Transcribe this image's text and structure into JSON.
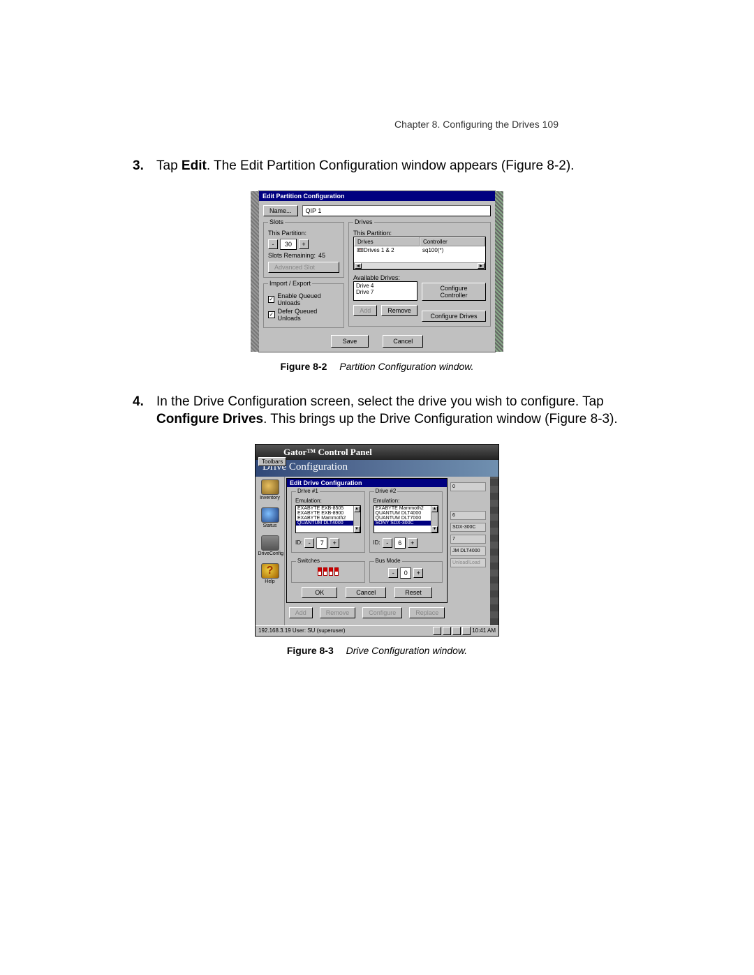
{
  "header": "Chapter 8. Configuring the Drives   109",
  "steps": {
    "s3_num": "3.",
    "s3_a": "Tap ",
    "s3_b": "Edit",
    "s3_c": ". The Edit Partition Configuration window appears (Figure 8-2).",
    "s4_num": "4.",
    "s4_a": "In the Drive Configuration screen, select the drive you wish to configure. Tap ",
    "s4_b": "Configure Drives",
    "s4_c": ". This brings up the Drive Configuration window (Figure 8-3)."
  },
  "fig82": {
    "label": "Figure 8-2",
    "title": "Partition Configuration window.",
    "win_title": "Edit Partition Configuration",
    "name_btn": "Name...",
    "name_value": "QIP 1",
    "slots_legend": "Slots",
    "slots_thispart": "This Partition:",
    "slots_value": "30",
    "slots_remaining_lbl": "Slots Remaining:",
    "slots_remaining_val": "45",
    "adv_slot": "Advanced Slot",
    "impexp_legend": "Import / Export",
    "chk1": "Enable Queued Unloads",
    "chk2": "Defer Queued Unloads",
    "drives_legend": "Drives",
    "drives_thispart": "This Partition:",
    "col_drives": "Drives",
    "col_ctrl": "Controller",
    "row_drives": "Drives 1 & 2",
    "row_ctrl": "sq100(*)",
    "avail_lbl": "Available Drives:",
    "avail_1": "Drive 4",
    "avail_2": "Drive 7",
    "cfg_ctrl": "Configure Controller",
    "cfg_drv": "Configure Drives",
    "add": "Add",
    "remove": "Remove",
    "save": "Save",
    "cancel": "Cancel"
  },
  "fig83": {
    "label": "Figure 8-3",
    "title": "Drive Configuration window.",
    "banner": "Gator™ Control Panel",
    "toolbars": "Toolbars",
    "subtitle": "Drive Configuration",
    "sidebar": {
      "inventory": "Inventory",
      "status": "Status",
      "drives": "DriveConfig",
      "help": "Help"
    },
    "panel_title": "Edit Drive Configuration",
    "drv1_legend": "Drive #1",
    "drv2_legend": "Drive #2",
    "emul": "Emulation:",
    "drv1_opts": [
      "EXABYTE EXB-8505",
      "EXABYTE EXB-8900",
      "EXABYTE Mammoth2",
      "QUANTUM DLT4000"
    ],
    "drv1_sel_index": 3,
    "drv2_opts": [
      "EXABYTE Mammoth2",
      "QUANTUM DLT4000",
      "QUANTUM DLT7000",
      "SONY SDX-300C"
    ],
    "drv2_sel_index": 3,
    "id_lbl": "ID:",
    "id1": "7",
    "id2": "6",
    "switches": "Switches",
    "busmode": "Bus Mode",
    "bus_val": "0",
    "ok": "OK",
    "cancel": "Cancel",
    "reset": "Reset",
    "add": "Add",
    "remove": "Remove",
    "configure": "Configure",
    "replace": "Replace",
    "rear": {
      "a": "0",
      "b": "6",
      "c": "SDX-300C",
      "d": "7",
      "e": "JM DLT4000",
      "f": "Unload/Load"
    },
    "status_left": "192.168.3.19 User: SU (superuser)",
    "status_time": "10:41 AM"
  }
}
